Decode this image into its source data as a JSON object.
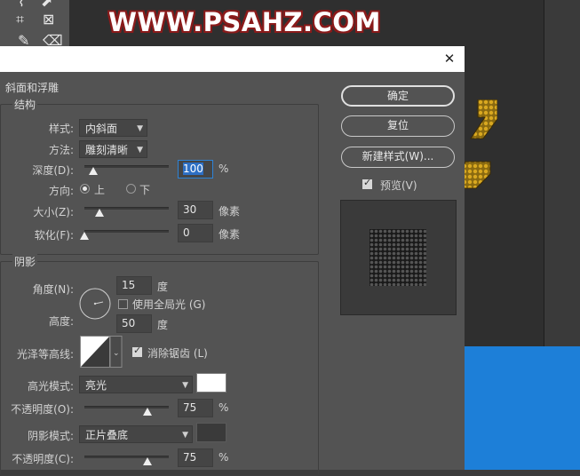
{
  "background": {
    "banner_text": "WWW.PSAHZ.COM",
    "tools": [
      "lasso-icon",
      "crop-icon",
      "frame-icon",
      "eyedropper-icon",
      "eraser-icon"
    ]
  },
  "dialog": {
    "section_title": "斜面和浮雕",
    "structure": {
      "title": "结构",
      "style_label": "样式:",
      "style_value": "内斜面",
      "technique_label": "方法:",
      "technique_value": "雕刻清晰",
      "depth_label": "深度(D):",
      "depth_value": "100",
      "depth_unit": "%",
      "direction_label": "方向:",
      "direction_up": "上",
      "direction_down": "下",
      "size_label": "大小(Z):",
      "size_value": "30",
      "size_unit": "像素",
      "soften_label": "软化(F):",
      "soften_value": "0",
      "soften_unit": "像素"
    },
    "shading": {
      "title": "阴影",
      "angle_label": "角度(N):",
      "angle_value": "15",
      "angle_unit": "度",
      "global_light_label": "使用全局光 (G)",
      "altitude_label": "高度:",
      "altitude_value": "50",
      "altitude_unit": "度",
      "gloss_contour_label": "光泽等高线:",
      "anti_alias_label": "消除锯齿 (L)",
      "highlight_mode_label": "高光模式:",
      "highlight_mode_value": "亮光",
      "highlight_opacity_label": "不透明度(O):",
      "highlight_opacity_value": "75",
      "highlight_opacity_unit": "%",
      "shadow_mode_label": "阴影模式:",
      "shadow_mode_value": "正片叠底",
      "shadow_opacity_label": "不透明度(C):",
      "shadow_opacity_value": "75",
      "shadow_opacity_unit": "%",
      "highlight_color": "#ffffff",
      "shadow_color": "#3a3a3a"
    },
    "buttons": {
      "ok": "确定",
      "reset": "复位",
      "new_style": "新建样式(W)...",
      "preview_label": "预览(V)"
    },
    "sliders": {
      "depth_fraction": 0.1,
      "size_fraction": 0.18,
      "soften_fraction": 0.0,
      "highlight_opacity_fraction": 0.75,
      "shadow_opacity_fraction": 0.75
    }
  }
}
